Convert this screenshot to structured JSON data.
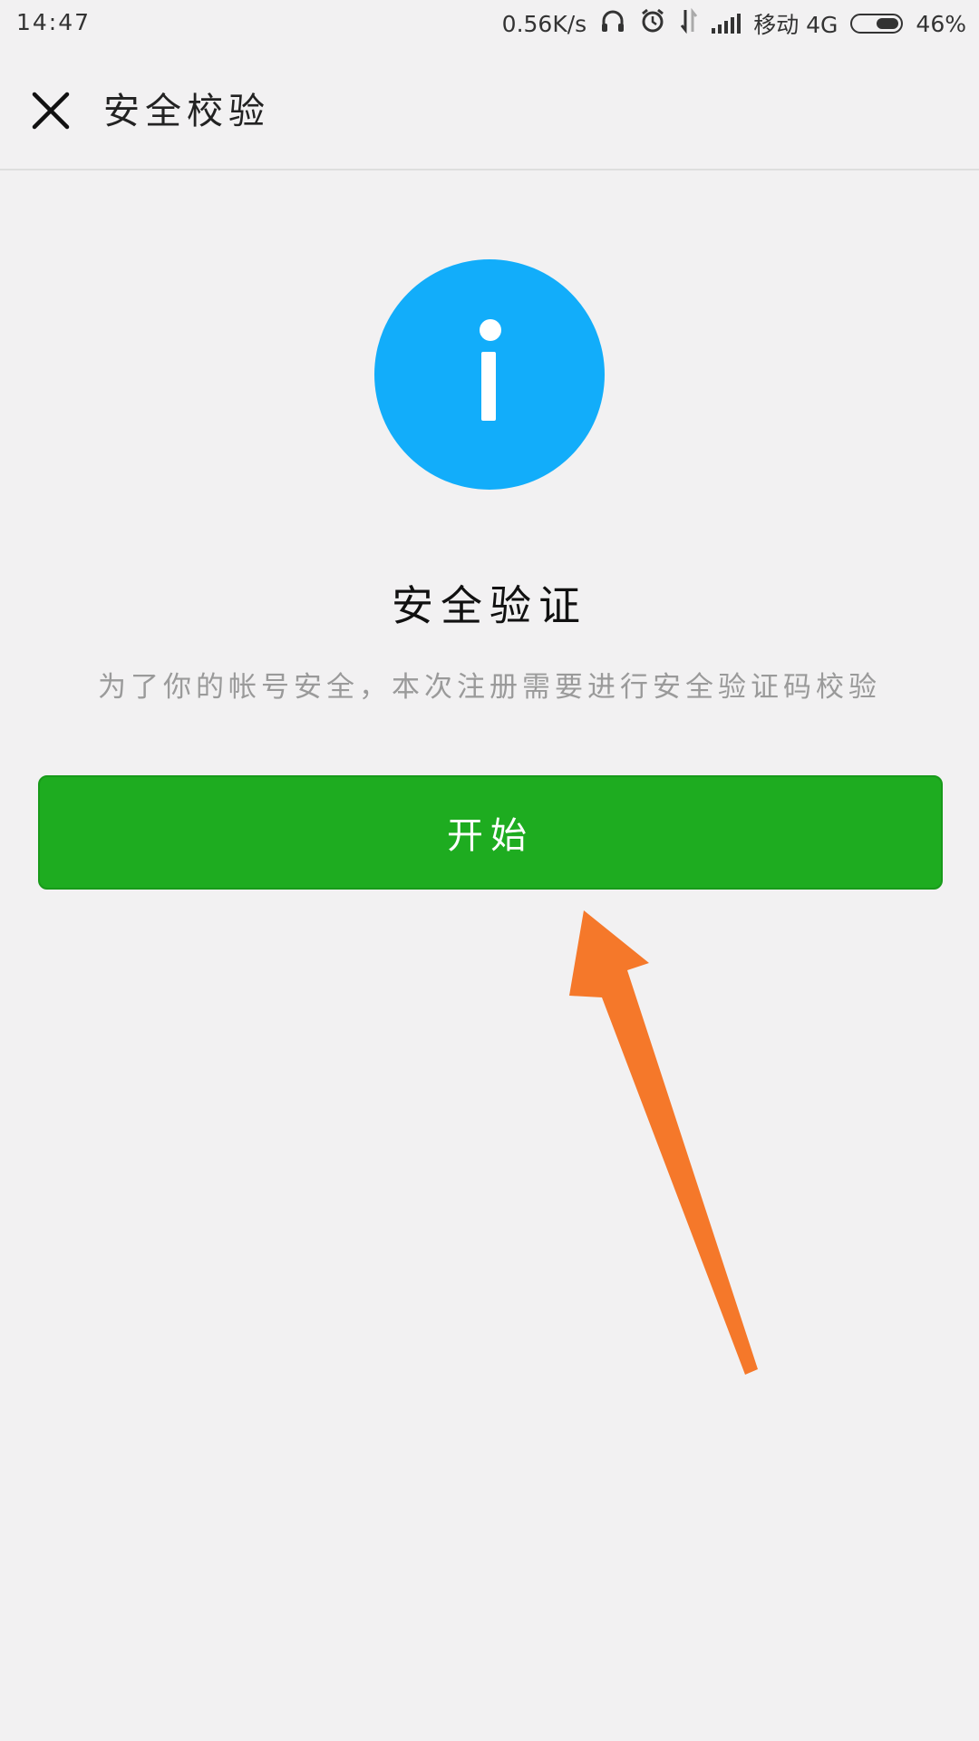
{
  "status_bar": {
    "time": "14:47",
    "speed": "0.56K/s",
    "carrier": "移动 4G",
    "battery": "46%",
    "battery_level": 0.46
  },
  "header": {
    "title": "安全校验"
  },
  "main": {
    "title": "安全验证",
    "description": "为了你的帐号安全，本次注册需要进行安全验证码校验",
    "start_label": "开始"
  },
  "colors": {
    "info_blue": "#12adfa",
    "button_green": "#1eac20",
    "annotation_arrow": "#f5782a"
  }
}
